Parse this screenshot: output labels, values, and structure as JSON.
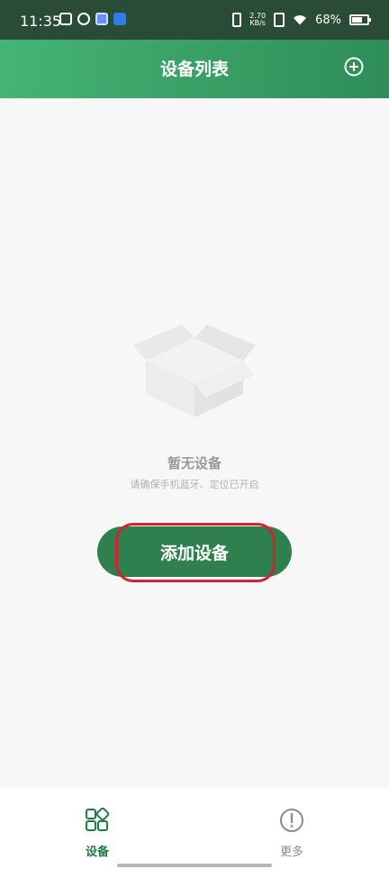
{
  "status_bar": {
    "time": "11:35",
    "network_speed_top": "2.70",
    "network_speed_unit": "KB/s",
    "battery_percent": "68%",
    "battery_level": 0.68
  },
  "app_bar": {
    "title": "设备列表",
    "add_icon": "plus-circle-icon"
  },
  "empty_state": {
    "icon": "empty-box-icon",
    "title": "暂无设备",
    "subtitle": "请确保手机蓝牙、定位已开启"
  },
  "actions": {
    "add_device_label": "添加设备"
  },
  "bottom_nav": {
    "items": [
      {
        "label": "设备",
        "icon": "grid-icon",
        "active": true
      },
      {
        "label": "更多",
        "icon": "info-circle-icon",
        "active": false
      }
    ]
  },
  "colors": {
    "accent": "#2f7f4f",
    "header_gradient_start": "#45b475",
    "header_gradient_end": "#2f8d57",
    "highlight": "#d4222e"
  }
}
